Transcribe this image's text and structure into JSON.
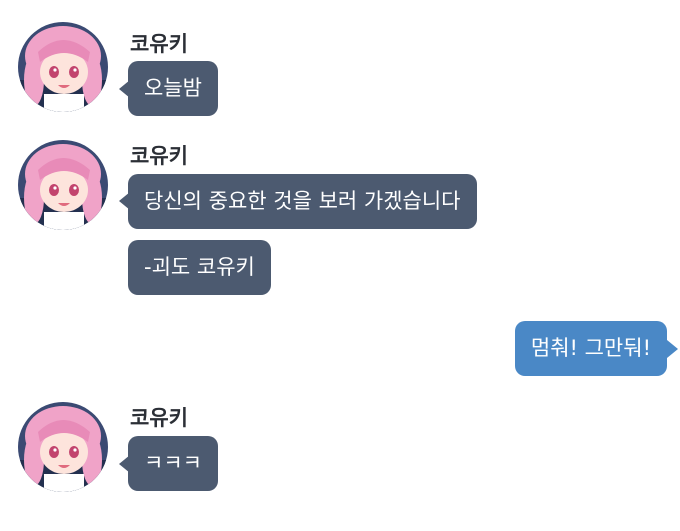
{
  "messages": [
    {
      "sender": "코유키",
      "avatar_icon": "pink-haired-girl-avatar-icon",
      "bubbles": [
        "오늘밤"
      ]
    },
    {
      "sender": "코유키",
      "avatar_icon": "pink-haired-girl-avatar-icon",
      "bubbles": [
        "당신의 중요한 것을 보러 가겠습니다",
        "-괴도 코유키"
      ]
    },
    {
      "sender": "me",
      "bubbles": [
        "멈춰! 그만둬!"
      ]
    },
    {
      "sender": "코유키",
      "avatar_icon": "pink-haired-girl-avatar-icon",
      "bubbles": [
        "ㅋㅋㅋ"
      ]
    }
  ],
  "colors": {
    "incoming_bubble": "#4c5a70",
    "outgoing_bubble": "#4a88c6",
    "bubble_text": "#ffffff",
    "sender_name": "#2b2f36",
    "background": "#ffffff"
  }
}
